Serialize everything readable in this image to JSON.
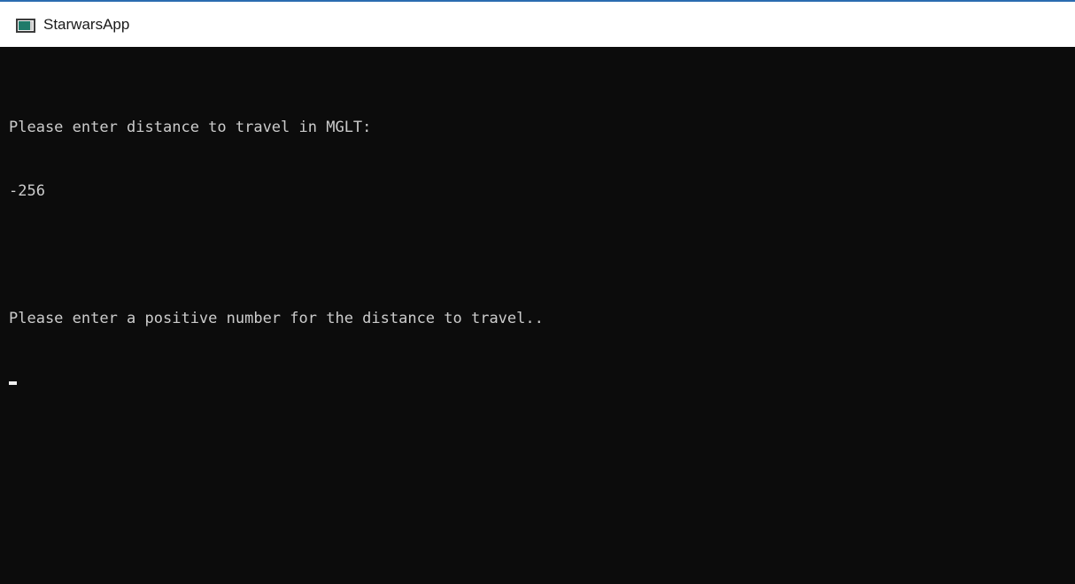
{
  "window": {
    "title": "StarwarsApp",
    "icon": "console-app-icon"
  },
  "console": {
    "lines": [
      "Please enter distance to travel in MGLT:",
      "-256",
      "",
      "Please enter a positive number for the distance to travel.."
    ]
  },
  "colors": {
    "console_background": "#0c0c0c",
    "console_text": "#cccccc",
    "titlebar_background": "#ffffff",
    "accent": "#2b6cb0"
  }
}
